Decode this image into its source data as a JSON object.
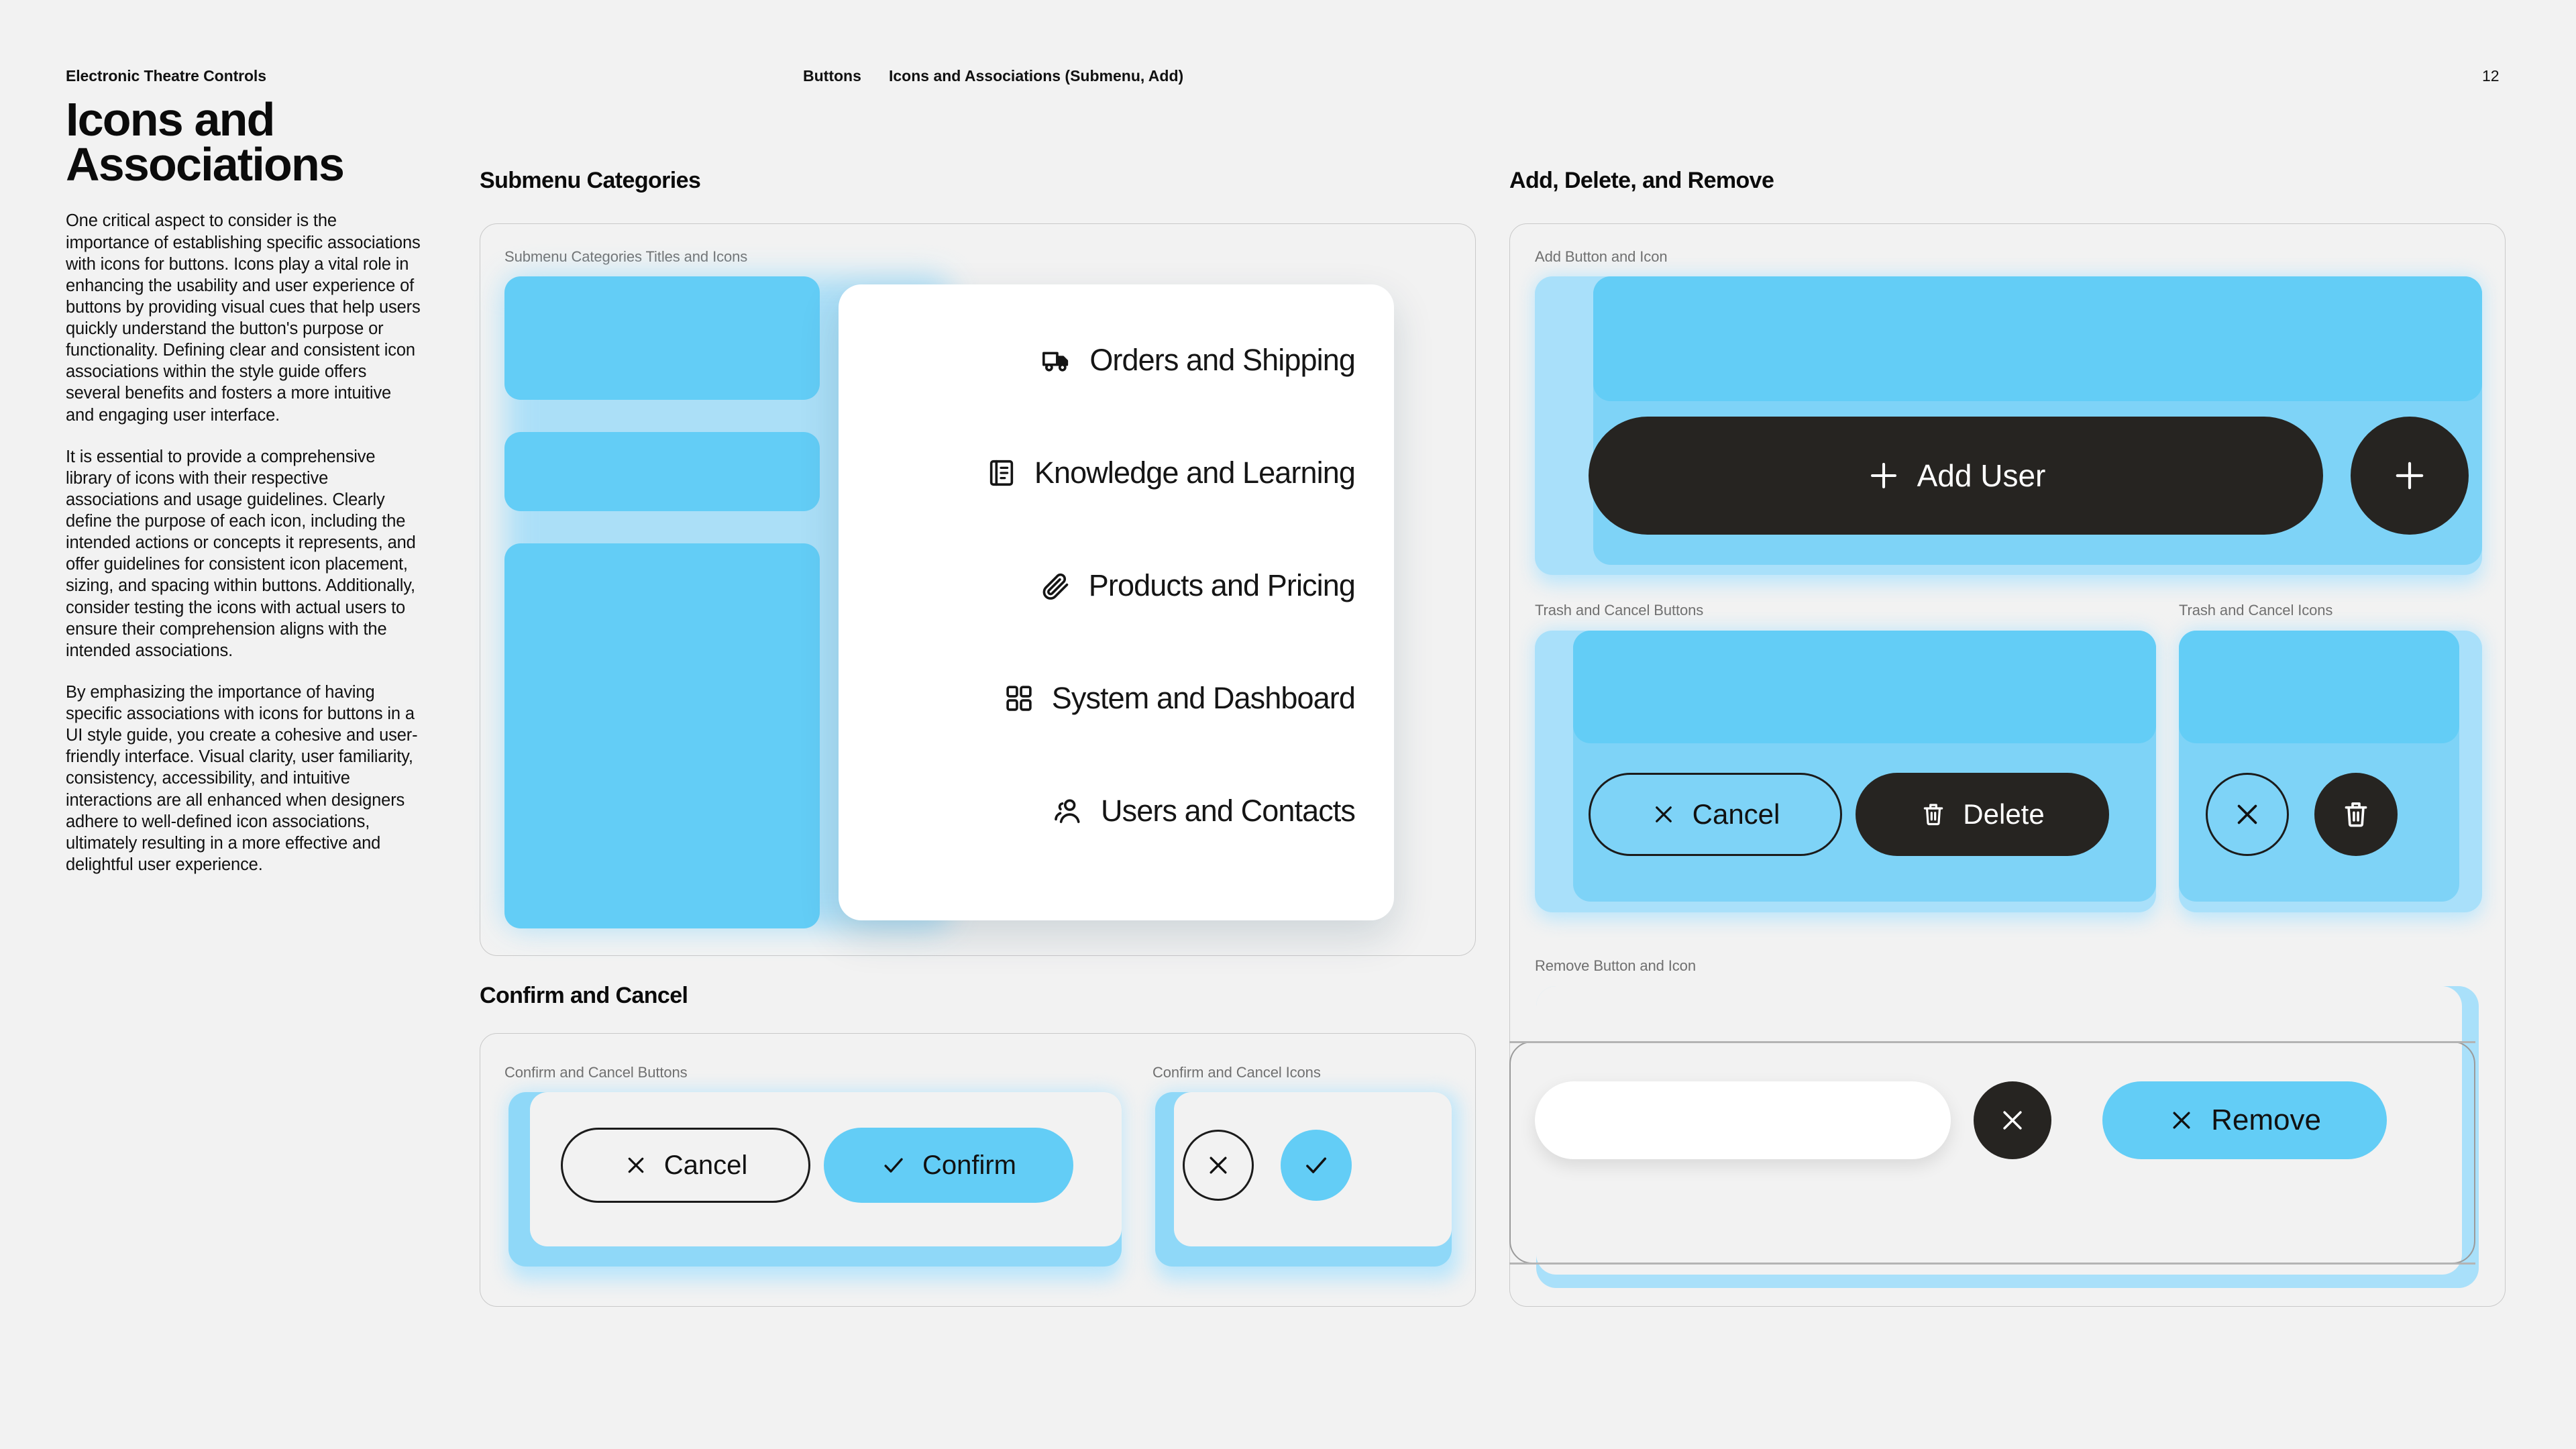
{
  "header": {
    "brand": "Electronic Theatre Controls",
    "crumb_section": "Buttons",
    "crumb_page": "Icons and Associations (Submenu, Add)",
    "page_number": "12"
  },
  "intro": {
    "title": "Icons and Associations",
    "paragraph_1": "One critical aspect to consider is the importance of establishing specific associations with icons for buttons. Icons play a vital role in enhancing the usability and user experience of buttons by providing visual cues that help users quickly understand the button's purpose or functionality. Defining clear and consistent icon associations within the style guide offers several benefits and fosters a more intuitive and engaging user interface.",
    "paragraph_2": "It is essential to provide a comprehensive library of icons with their respective associations and usage guidelines. Clearly define the purpose of each icon, including the intended actions or concepts it represents, and offer guidelines for consistent icon placement, sizing, and spacing within buttons. Additionally, consider testing the icons with actual users to ensure their comprehension aligns with the intended associations.",
    "paragraph_3": "By emphasizing the importance of having specific associations with icons for buttons in a UI style guide, you create a cohesive and user-friendly interface. Visual clarity, user familiarity, consistency, accessibility, and intuitive interactions are all enhanced when designers adhere to well-defined icon associations, ultimately resulting in a more effective and delightful user experience."
  },
  "submenu_section": {
    "heading": "Submenu Categories",
    "caption": "Submenu Categories Titles and Icons",
    "items": [
      {
        "label": "Orders and Shipping",
        "icon": "truck-icon"
      },
      {
        "label": "Knowledge and Learning",
        "icon": "book-list-icon"
      },
      {
        "label": "Products and Pricing",
        "icon": "paperclip-icon"
      },
      {
        "label": "System and Dashboard",
        "icon": "grid-icon"
      },
      {
        "label": "Users and Contacts",
        "icon": "users-icon"
      }
    ]
  },
  "confirm_section": {
    "heading": "Confirm and Cancel",
    "buttons_caption": "Confirm and Cancel Buttons",
    "icons_caption": "Confirm and Cancel Icons",
    "cancel_label": "Cancel",
    "confirm_label": "Confirm",
    "cancel_icon": "close-x-icon",
    "confirm_icon": "check-icon"
  },
  "add_section": {
    "heading": "Add, Delete, and Remove",
    "add_caption": "Add Button and Icon",
    "add_label": "Add User",
    "add_icon": "plus-icon",
    "trash_caption": "Trash and Cancel Buttons",
    "trash_icons_caption": "Trash and Cancel Icons",
    "cancel_label": "Cancel",
    "delete_label": "Delete",
    "cancel_icon": "close-x-icon",
    "delete_icon": "trash-icon",
    "remove_caption": "Remove Button and Icon",
    "remove_label": "Remove",
    "remove_icon": "close-x-icon",
    "remove_field_value": ""
  },
  "colors": {
    "accent_blue": "#63cdf6",
    "pale_blue": "#b9e5fb",
    "dark": "#262421",
    "page_bg": "#f2f2f2",
    "panel_border": "#c9c9c9",
    "caption_gray": "#6f6f6f"
  }
}
